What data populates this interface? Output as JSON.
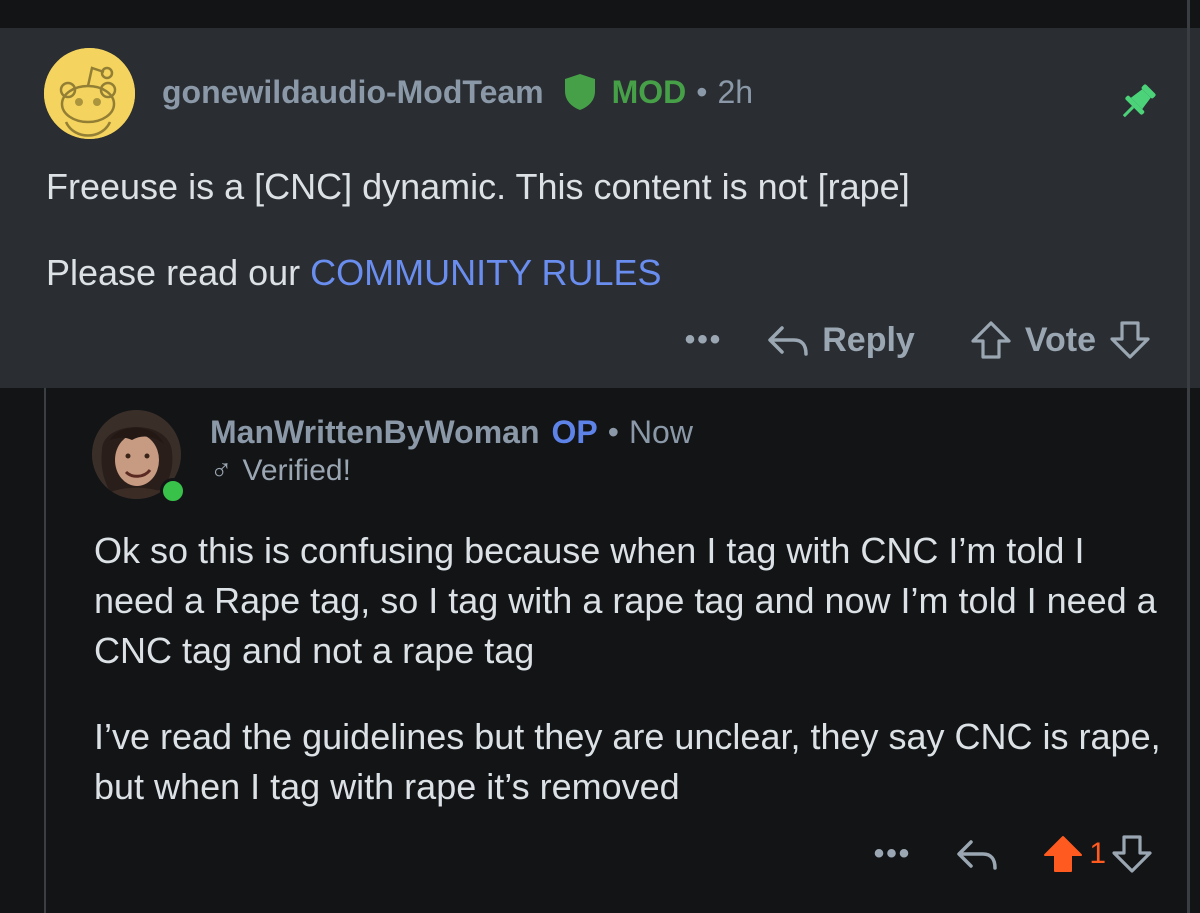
{
  "mod_comment": {
    "username": "gonewildaudio-ModTeam",
    "mod_label": "MOD",
    "separator": "•",
    "time": "2h",
    "line1": "Freeuse is a [CNC] dynamic. This content is not [rape]",
    "line2_prefix": "Please read our ",
    "line2_link": "COMMUNITY RULES",
    "actions": {
      "more": "•••",
      "reply": "Reply",
      "vote": "Vote"
    },
    "icons": {
      "avatar": "snoo-avatar",
      "badge": "shield-icon",
      "pin": "pin-icon"
    }
  },
  "reply_comment": {
    "username": "ManWrittenByWoman",
    "op_label": "OP",
    "separator": "•",
    "time": "Now",
    "flair_symbol": "♂",
    "flair_text": "Verified!",
    "paragraph1": "Ok so this is confusing because when I tag with CNC I’m told I need a Rape tag, so I tag with a rape tag and now I’m told I need a CNC tag and not a rape tag",
    "paragraph2": "I’ve read the guidelines but they are unclear, they say CNC is rape, but when I tag with rape it’s removed",
    "actions": {
      "more": "•••",
      "vote_count": "1"
    },
    "icons": {
      "avatar": "user-avatar",
      "online": "online-status-dot"
    }
  },
  "colors": {
    "mod_bg": "#2a2e32",
    "reply_bg": "#121416",
    "mod_green": "#46a047",
    "op_blue": "#5e83e8",
    "link_blue": "#6a8df0",
    "upvote_orange": "#ff5a1f",
    "meta_gray": "#8a98a8",
    "text_light": "#dce1e6"
  }
}
